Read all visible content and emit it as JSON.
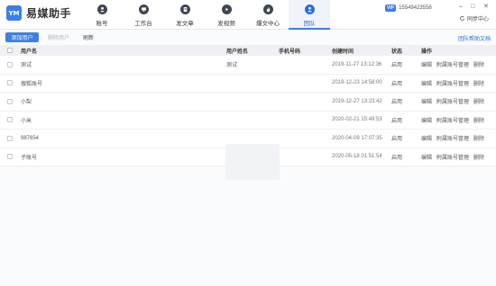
{
  "app": {
    "logo_mark": "YM",
    "title": "易媒助手"
  },
  "nav": {
    "tabs": [
      {
        "label": "账号",
        "icon": "user-icon"
      },
      {
        "label": "工作台",
        "icon": "monitor-icon"
      },
      {
        "label": "发文章",
        "icon": "article-icon"
      },
      {
        "label": "发视频",
        "icon": "video-icon"
      },
      {
        "label": "爆文中心",
        "icon": "flame-icon"
      },
      {
        "label": "团队",
        "icon": "team-icon",
        "active": true
      }
    ]
  },
  "header": {
    "vip_label": "VIP",
    "phone": "15549423558",
    "sync_label": "同步中心",
    "controls": {
      "minimize": "–",
      "maximize": "□",
      "close": "✕"
    }
  },
  "toolbar": {
    "add_user": "添加用户",
    "delete_user": "删除用户",
    "refresh": "刷新",
    "help": "团队帮助文档"
  },
  "table": {
    "headers": {
      "username": "用户名",
      "real_name": "用户姓名",
      "phone": "手机号码",
      "created": "创建时间",
      "status": "状态",
      "actions": "操作"
    },
    "rows": [
      {
        "username": "测试",
        "real_name": "测试",
        "phone": "",
        "created": "2019-11-27 13:12:36",
        "status": "启用"
      },
      {
        "username": "搜狐账号",
        "real_name": "",
        "phone": "",
        "created": "2019-12-23 14:58:00",
        "status": "启用"
      },
      {
        "username": "小梨",
        "real_name": "",
        "phone": "",
        "created": "2019-12-27 13:23:42",
        "status": "启用"
      },
      {
        "username": "小米",
        "real_name": "",
        "phone": "",
        "created": "2020-02-21 15:49:53",
        "status": "启用"
      },
      {
        "username": "987654",
        "real_name": "",
        "phone": "",
        "created": "2020-04-09 17:07:35",
        "status": "启用"
      },
      {
        "username": "子账号",
        "real_name": "",
        "phone": "",
        "created": "2020-05-18 01:51:54",
        "status": "启用"
      }
    ],
    "row_actions": {
      "edit": "编辑",
      "sub_accounts": "附属账号管理",
      "delete": "删除"
    }
  },
  "colors": {
    "accent": "#3d7fe5",
    "nav_dark": "#3f4550"
  }
}
